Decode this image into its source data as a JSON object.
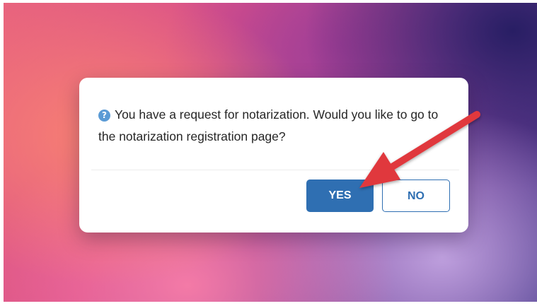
{
  "dialog": {
    "icon": "question-circle-icon",
    "icon_glyph": "?",
    "message": "You have a request for notarization. Would you like to go to the notarization registration page?",
    "yes_label": "YES",
    "no_label": "NO"
  },
  "annotation": {
    "icon": "red-pointer-arrow",
    "color": "#e0373d"
  },
  "colors": {
    "primary": "#2f6fb2",
    "info_icon": "#5b9bd5"
  }
}
